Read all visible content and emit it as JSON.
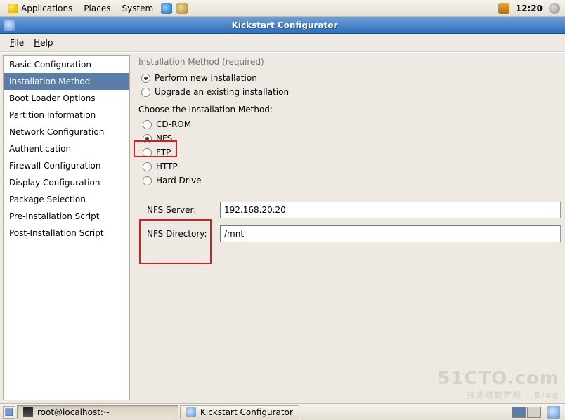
{
  "panel": {
    "apps": "Applications",
    "places": "Places",
    "system": "System",
    "clock": "12:20"
  },
  "window": {
    "title": "Kickstart Configurator"
  },
  "menubar": {
    "file": "File",
    "help": "Help"
  },
  "sidebar": {
    "items": [
      "Basic Configuration",
      "Installation Method",
      "Boot Loader Options",
      "Partition Information",
      "Network Configuration",
      "Authentication",
      "Firewall Configuration",
      "Display Configuration",
      "Package Selection",
      "Pre-Installation Script",
      "Post-Installation Script"
    ],
    "selected_index": 1
  },
  "content": {
    "section_title": "Installation Method (required)",
    "install_mode": {
      "new_label": "Perform new installation",
      "upgrade_label": "Upgrade an existing installation",
      "selected": "new"
    },
    "method_label": "Choose the Installation Method:",
    "methods": [
      "CD-ROM",
      "NFS",
      "FTP",
      "HTTP",
      "Hard Drive"
    ],
    "method_selected_index": 1,
    "nfs": {
      "server_label": "NFS Server:",
      "server_value": "192.168.20.20",
      "dir_label": "NFS Directory:",
      "dir_value": "/mnt"
    }
  },
  "taskbar": {
    "terminal": "root@localhost:~",
    "app": "Kickstart Configurator"
  },
  "watermark": {
    "main": "51CTO.com",
    "sub": "技术成就梦想 · Blog"
  }
}
